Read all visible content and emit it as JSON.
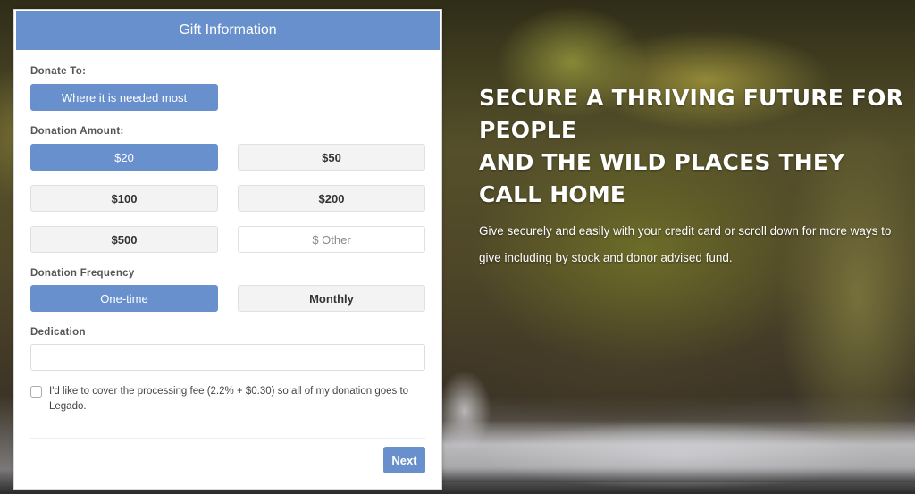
{
  "hero": {
    "title_line1": "Secure a thriving future for people",
    "title_line2": "and the wild places they call home",
    "subtitle": "Give securely and easily with your credit card or scroll down for more ways to give including by stock and donor advised fund."
  },
  "form": {
    "header": "Gift Information",
    "donate_to": {
      "label": "Donate To:",
      "selected": "Where it is needed most"
    },
    "amount": {
      "label": "Donation Amount:",
      "options": [
        "$20",
        "$50",
        "$100",
        "$200",
        "$500"
      ],
      "selected": "$20",
      "other_placeholder": "$ Other"
    },
    "frequency": {
      "label": "Donation Frequency",
      "options": [
        "One-time",
        "Monthly"
      ],
      "selected": "One-time"
    },
    "dedication": {
      "label": "Dedication",
      "value": "",
      "placeholder": ""
    },
    "fee": {
      "checked": false,
      "label": "I'd like to cover the processing fee (2.2% + $0.30) so all of my donation goes to Legado."
    },
    "next_label": "Next"
  },
  "colors": {
    "accent": "#6890cd",
    "option_bg": "#f3f3f3"
  }
}
